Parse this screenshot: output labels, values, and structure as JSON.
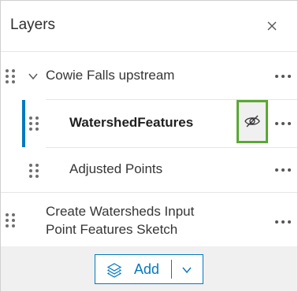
{
  "panel": {
    "title": "Layers",
    "close_icon": "close-icon"
  },
  "layers": [
    {
      "label": "Cowie Falls upstream",
      "kind": "group",
      "expanded": true
    },
    {
      "label": "WatershedFeatures",
      "kind": "child",
      "selected": true,
      "visibility_icon": "eye-off-icon"
    },
    {
      "label": "Adjusted Points",
      "kind": "child"
    },
    {
      "label_line1": "Create Watersheds Input",
      "label_line2": "Point Features Sketch",
      "kind": "layer"
    }
  ],
  "footer": {
    "add_label": "Add",
    "add_icon": "layers-icon",
    "dropdown_icon": "chevron-down-icon"
  },
  "colors": {
    "accent": "#0079c1",
    "highlight_border": "#5aa833",
    "footer_bg": "#f0f0f0"
  }
}
